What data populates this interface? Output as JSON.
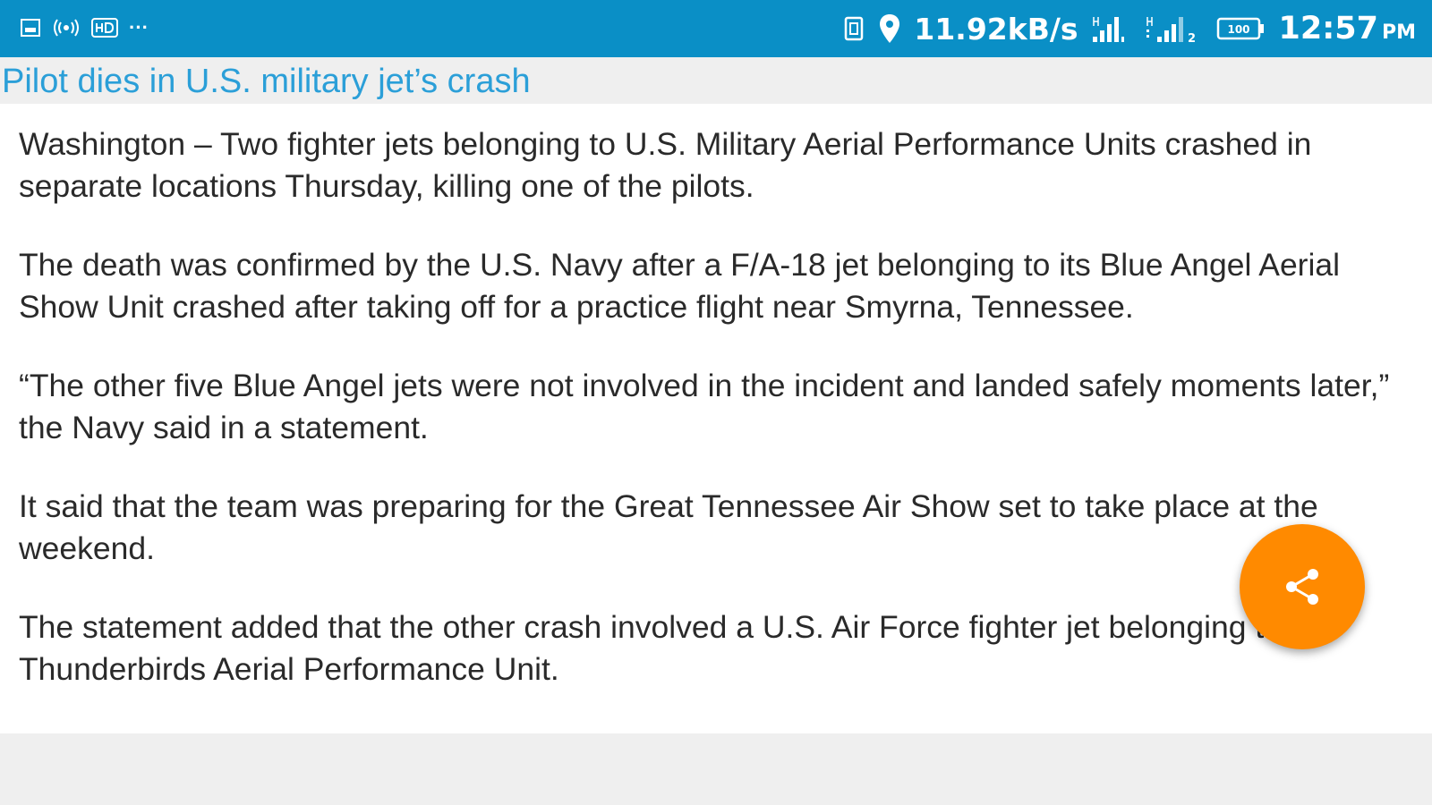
{
  "status_bar": {
    "left_icons": [
      "image-icon",
      "hotspot-icon",
      "hd-icon",
      "more-dots-icon"
    ],
    "more_text": "···",
    "net_speed": "11.92kB/s",
    "time": "12:57",
    "ampm": "PM",
    "battery_level": "100",
    "background_color": "#0a8fc6"
  },
  "article": {
    "title": "Pilot dies in U.S. military jet’s crash",
    "title_color": "#2b9fd8",
    "paragraphs": [
      "Washington – Two fighter jets belonging to U.S. Military Aerial Performance Units crashed in separate locations Thursday, killing one of the pilots.",
      "The death was confirmed by the U.S. Navy after a F/A-18 jet belonging to its Blue Angel Aerial Show Unit crashed after taking off for a practice flight near Smyrna, Tennessee.",
      "“The other five Blue Angel jets were not involved in the incident and landed safely moments later,” the Navy said in a statement.",
      "It said that the team was preparing for the Great Tennessee Air Show set to take place at the weekend.",
      "The statement added that the other crash involved a U.S. Air Force fighter jet belonging to the Thunderbirds Aerial Performance Unit."
    ]
  },
  "share_button": {
    "icon": "share-icon",
    "color": "#ff8a00"
  }
}
